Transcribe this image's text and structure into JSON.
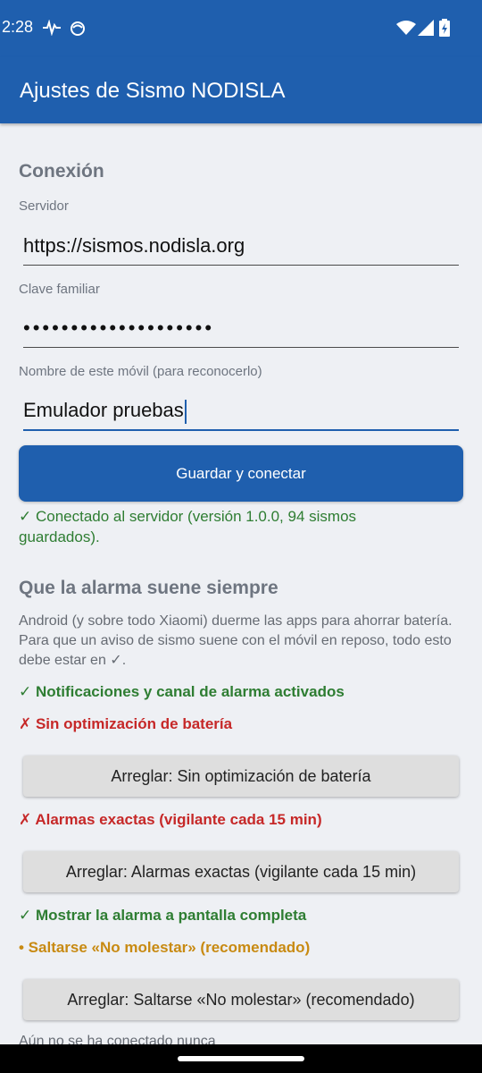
{
  "status": {
    "time": "2:28"
  },
  "app": {
    "title": "Ajustes de Sismo NODISLA"
  },
  "connection": {
    "section_title": "Conexión",
    "server_label": "Servidor",
    "server_value": "https://sismos.nodisla.org",
    "key_label": "Clave familiar",
    "key_value": "••••••••••••••••••••",
    "device_label": "Nombre de este móvil (para reconocerlo)",
    "device_value": "Emulador pruebas",
    "save_button": "Guardar y conectar",
    "status_msg": "✓ Conectado al servidor (versión 1.0.0, 94 sismos guardados)."
  },
  "alarm": {
    "section_title": "Que la alarma suene siempre",
    "description": "Android (y sobre todo Xiaomi) duerme las apps para ahorrar batería. Para que un aviso de sismo suene con el móvil en reposo, todo esto debe estar en ✓.",
    "checks": [
      {
        "text": "✓ Notificaciones y canal de alarma activados"
      },
      {
        "text": "✗ Sin optimización de batería"
      },
      {
        "text": "✗ Alarmas exactas (vigilante cada 15 min)"
      },
      {
        "text": "✓ Mostrar la alarma a pantalla completa"
      },
      {
        "text": "• Saltarse «No molestar» (recomendado)"
      }
    ],
    "fix_buttons": [
      {
        "label": "Arreglar: Sin optimización de batería"
      },
      {
        "label": "Arreglar: Alarmas exactas (vigilante cada 15 min)"
      },
      {
        "label": "Arreglar: Saltarse «No molestar» (recomendado)"
      }
    ],
    "footer": "Aún no se ha conectado nunca"
  },
  "colors": {
    "primary": "#1f5fae",
    "ok": "#2e7d32",
    "error": "#c62828",
    "warning": "#c88a12"
  }
}
